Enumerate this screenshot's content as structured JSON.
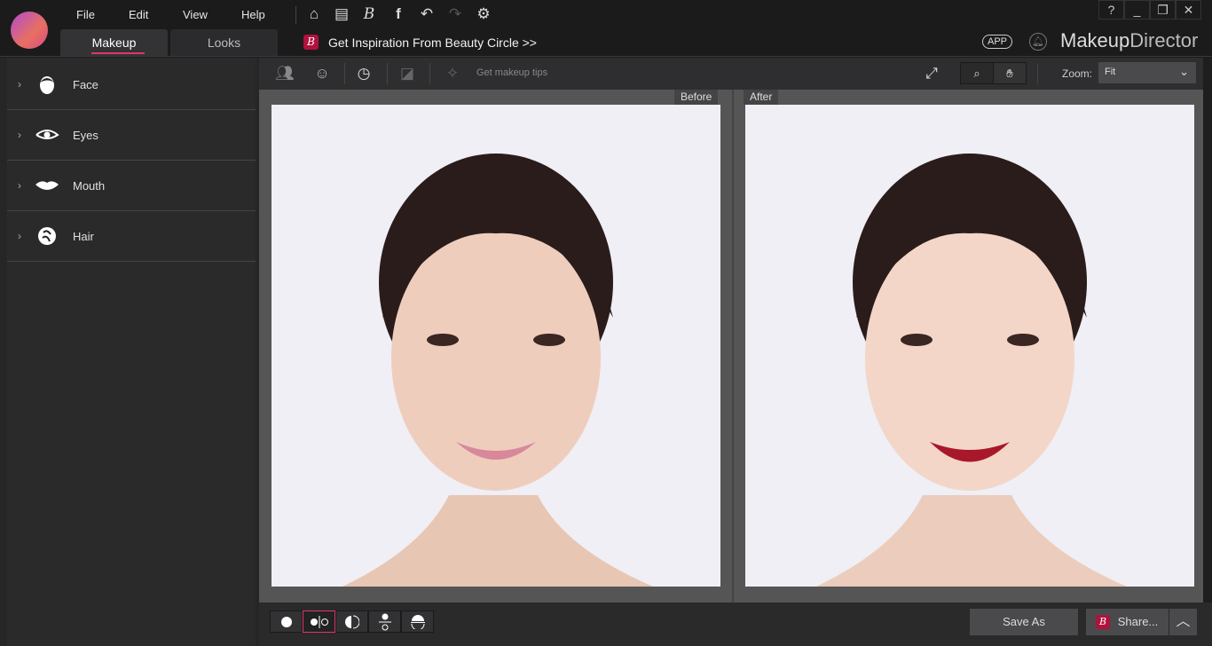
{
  "menu": [
    "File",
    "Edit",
    "View",
    "Help"
  ],
  "tabs": [
    "Makeup",
    "Looks"
  ],
  "promo": "Get Inspiration From Beauty Circle >>",
  "brand": {
    "bold": "Makeup",
    "light": "Director",
    "app_badge": "APP"
  },
  "window_buttons": [
    "?",
    "_",
    "❐",
    "✕"
  ],
  "sidebar": {
    "items": [
      {
        "label": "Face",
        "icon": "face-icon"
      },
      {
        "label": "Eyes",
        "icon": "eye-icon"
      },
      {
        "label": "Mouth",
        "icon": "lips-icon"
      },
      {
        "label": "Hair",
        "icon": "hair-icon"
      }
    ]
  },
  "toolbar": {
    "tips": "Get makeup tips",
    "zoom_label": "Zoom:",
    "zoom_value": "Fit"
  },
  "canvas": {
    "before": "Before",
    "after": "After"
  },
  "bottom": {
    "save_as": "Save As",
    "share": "Share..."
  },
  "colors": {
    "accent": "#e0356b",
    "lip_before": "#d7889a",
    "lip_after": "#a8182a"
  }
}
